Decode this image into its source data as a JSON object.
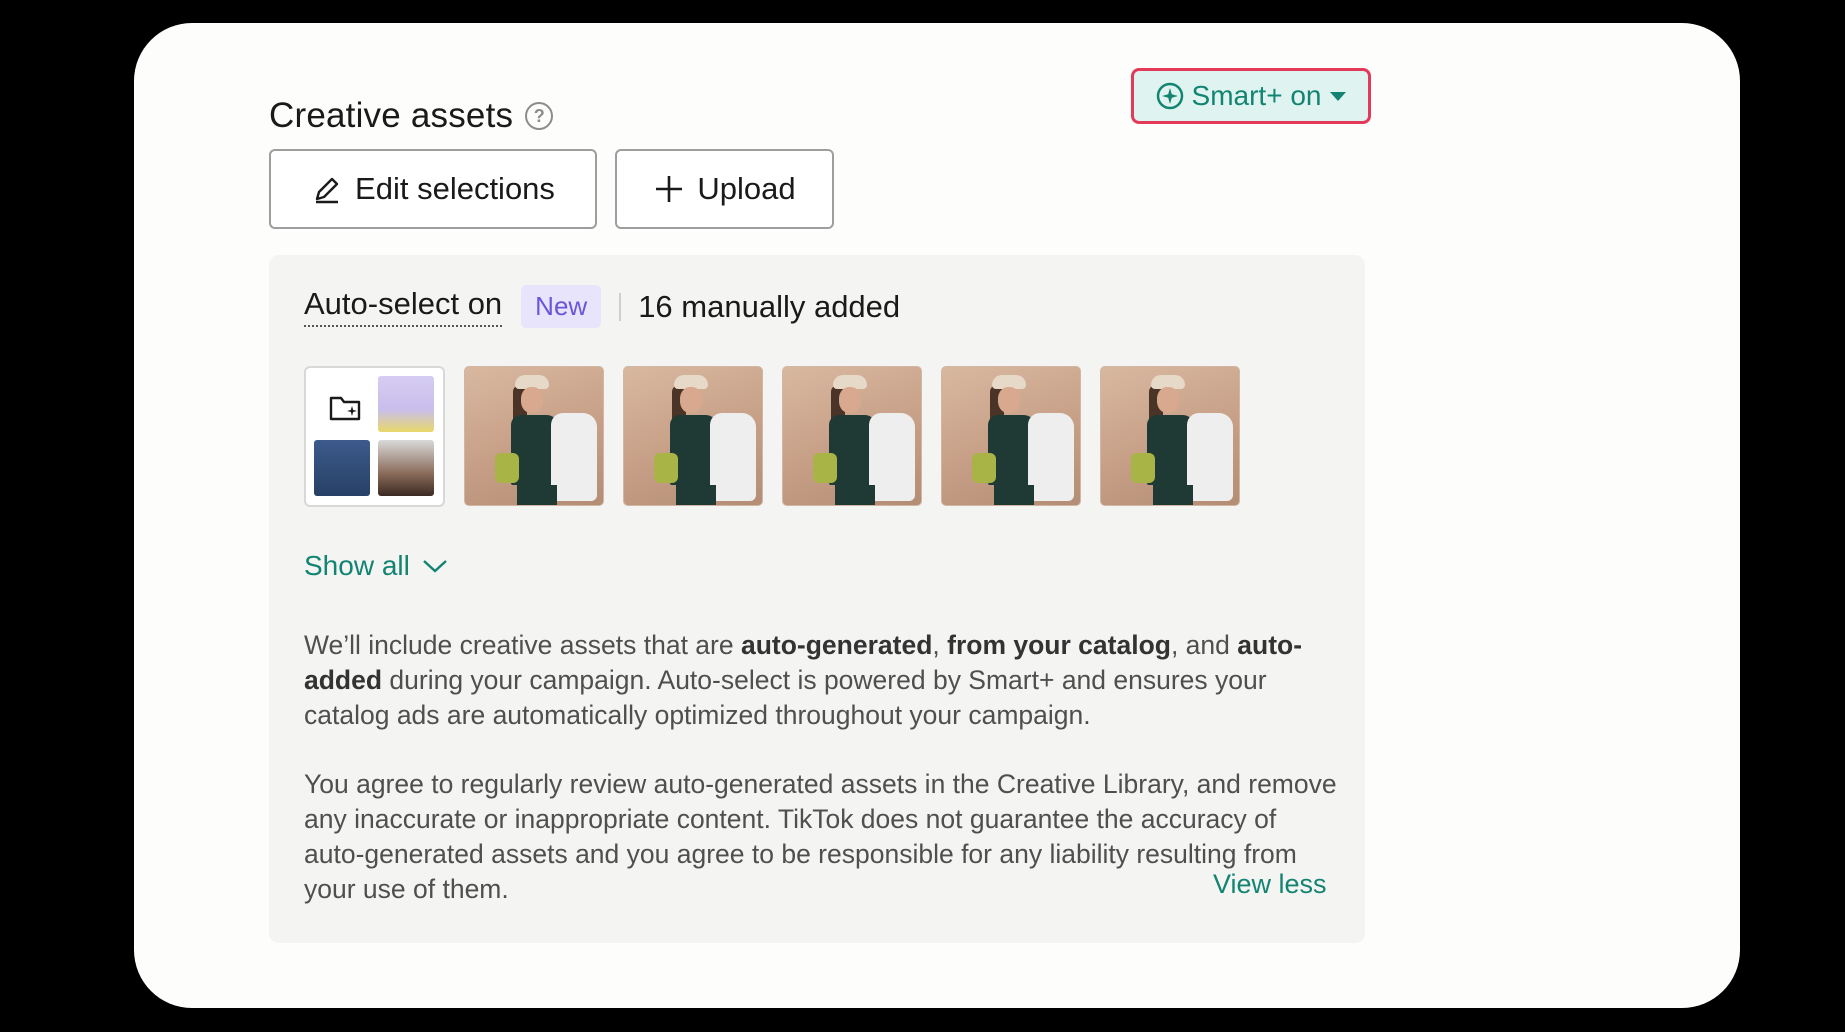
{
  "header": {
    "title": "Creative assets",
    "help_icon": "question-circle-icon",
    "smart_button_label": "Smart+ on"
  },
  "actions": {
    "edit_label": "Edit selections",
    "upload_label": "Upload"
  },
  "panel": {
    "auto_select_label": "Auto-select on",
    "new_badge": "New",
    "manual_count": "16 manually added",
    "show_all_label": "Show all",
    "para1": {
      "t1": "We’ll include creative assets that are ",
      "b1": "auto-generated",
      "t2": ", ",
      "b2": "from your catalog",
      "t3": ", and ",
      "b3": "auto-added",
      "t4": " during your campaign. Auto-select is powered by Smart+ and ensures your catalog ads are automatically optimized throughout your campaign."
    },
    "para2": "You agree to regularly review auto-generated assets in the Creative Library, and remove any inaccurate or inappropriate content. TikTok does not guarantee the accuracy of auto-generated assets and you agree to be responsible for any liability resulting from your use of them.",
    "view_less_label": "View less"
  },
  "colors": {
    "accent": "#138472",
    "highlight_border": "#e33a5a",
    "badge_bg": "#e8e4fb",
    "badge_text": "#6b55d9"
  }
}
